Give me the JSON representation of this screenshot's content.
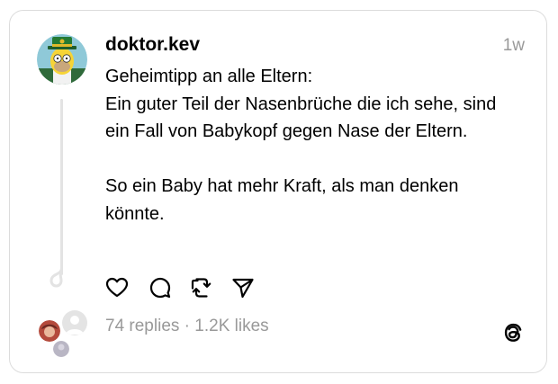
{
  "post": {
    "username": "doktor.kev",
    "time": "1w",
    "text": "Geheimtipp an alle Eltern:\nEin guter Teil der Nasenbrüche die ich sehe, sind ein Fall von Babykopf gegen Nase der Eltern.\n\nSo ein Baby hat mehr Kraft, als man denken könnte.",
    "replies": "74 replies",
    "separator": "·",
    "likes": "1.2K likes"
  },
  "icons": {
    "like": "heart-icon",
    "reply": "comment-bubble-icon",
    "repost": "repost-icon",
    "share": "send-icon",
    "brand": "threads-logo-icon"
  },
  "colors": {
    "text": "#000000",
    "muted": "#999999",
    "border": "#dcdcdc",
    "thread_line": "#e3e3e3"
  }
}
